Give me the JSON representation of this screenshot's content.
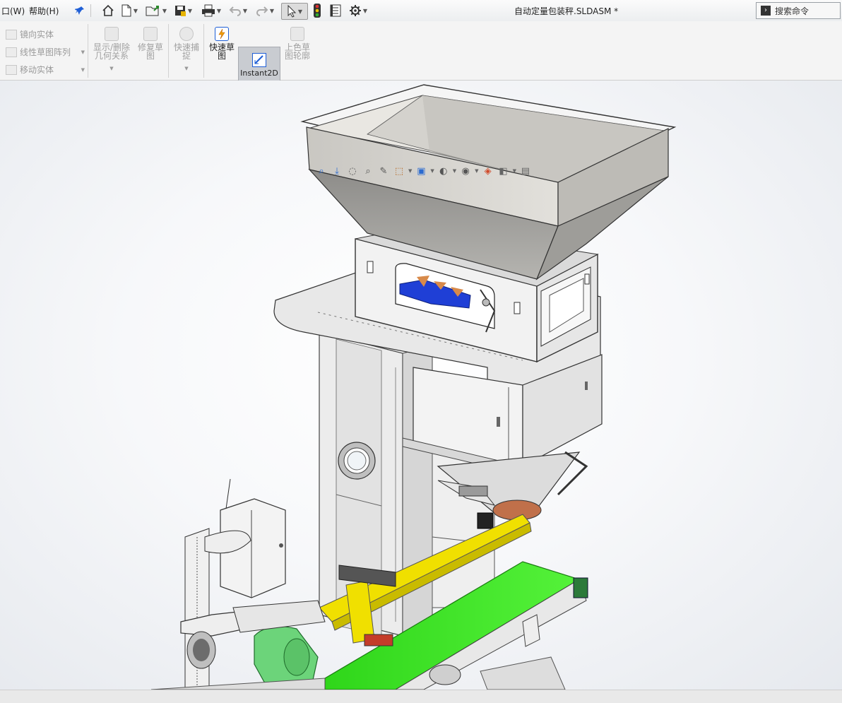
{
  "window": {
    "title": "自动定量包装秤.SLDASM *"
  },
  "menu": {
    "window_label": "口(W)",
    "help_label": "帮助(H)"
  },
  "search": {
    "placeholder": "搜索命令"
  },
  "ribbon": {
    "mirror_entities": "镜向实体",
    "linear_sketch_pattern": "线性草图阵列",
    "move_entities": "移动实体",
    "display_delete_relations_1": "显示/删除",
    "display_delete_relations_2": "几何关系",
    "repair_sketch_1": "修复草",
    "repair_sketch_2": "图",
    "quick_snaps_1": "快速捕",
    "quick_snaps_2": "捉",
    "rapid_sketch_1": "快速草",
    "rapid_sketch_2": "图",
    "instant2d": "Instant2D",
    "shaded_sketch_contours_1": "上色草",
    "shaded_sketch_contours_2": "图轮廓"
  },
  "toolbar_icons": [
    "pin-icon",
    "home-icon",
    "new-document-icon",
    "open-icon",
    "save-icon",
    "print-icon",
    "undo-icon",
    "redo-icon",
    "select-icon",
    "traffic-light-icon",
    "file-properties-icon",
    "gear-icon"
  ],
  "heads_up_icons": [
    "zoom-to-fit-icon",
    "zoom-to-area-icon",
    "previous-view-icon",
    "section-view-icon",
    "dynamic-annotation-icon",
    "view-orientation-icon",
    "display-style-icon",
    "hide-show-items-icon",
    "edit-appearance-icon",
    "apply-scene-icon",
    "view-settings-icon",
    "display-pane-icon"
  ],
  "colors": {
    "hopper": "#d8d6d0",
    "frame": "#ececec",
    "conveyor_belt": "#39e61e",
    "yellow_arm": "#f0e000",
    "motor_green": "#6cd47a",
    "blue_part": "#1f3fd6",
    "orange_part": "#d88a4a"
  }
}
